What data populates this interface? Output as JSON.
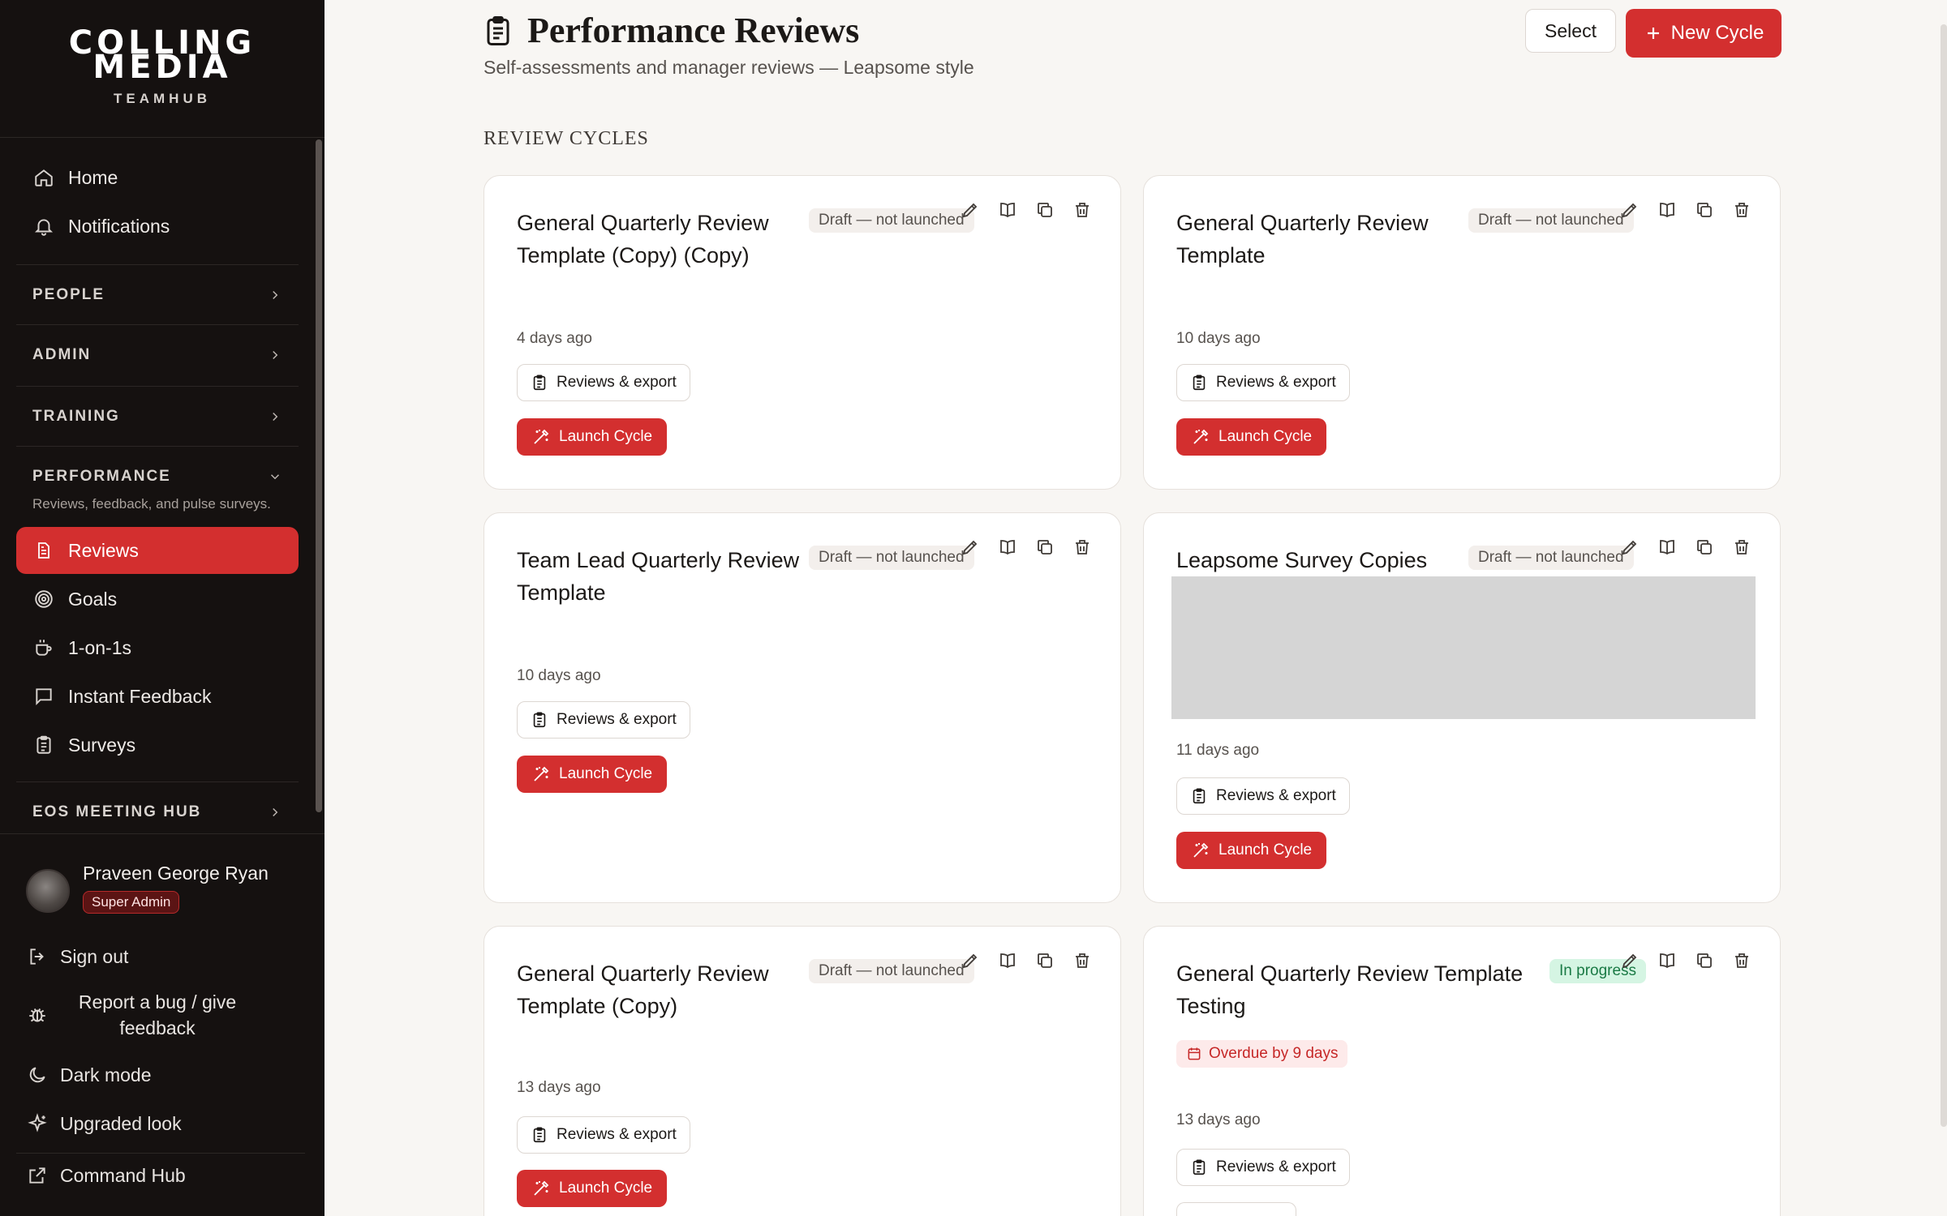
{
  "brand": {
    "name_line1": "COLLING",
    "name_line2": "MEDIA",
    "product": "TEAMHUB"
  },
  "nav": {
    "home": "Home",
    "notifications": "Notifications",
    "sections": [
      {
        "label": "PEOPLE"
      },
      {
        "label": "ADMIN"
      },
      {
        "label": "TRAINING"
      }
    ],
    "performance": {
      "label": "PERFORMANCE",
      "description": "Reviews, feedback, and pulse surveys.",
      "items": [
        "Reviews",
        "Goals",
        "1-on-1s",
        "Instant Feedback",
        "Surveys"
      ],
      "active": "Reviews"
    },
    "eos": "EOS MEETING HUB"
  },
  "user": {
    "name": "Praveen George Ryan",
    "role": "Super Admin"
  },
  "footer": {
    "sign_out": "Sign out",
    "report_line1": "Report a bug / give",
    "report_line2": "feedback",
    "dark_mode": "Dark mode",
    "upgraded_look": "Upgraded look",
    "command_hub": "Command Hub"
  },
  "header": {
    "title": "Performance Reviews",
    "subtitle": "Self-assessments and manager reviews — Leapsome style",
    "select_label": "Select",
    "new_cycle_label": "New Cycle"
  },
  "section_label": "REVIEW CYCLES",
  "card_labels": {
    "export": "Reviews & export",
    "launch": "Launch Cycle"
  },
  "cards": [
    {
      "title": "General Quarterly Review Template (Copy) (Copy)",
      "status": "Draft — not launched",
      "time": "4 days ago"
    },
    {
      "title": "General Quarterly Review Template",
      "status": "Draft — not launched",
      "time": "10 days ago"
    },
    {
      "title": "Team Lead Quarterly Review Template",
      "status": "Draft — not launched",
      "time": "10 days ago"
    },
    {
      "title": "Leapsome Survey Copies",
      "status": "Draft — not launched",
      "time": "11 days ago"
    },
    {
      "title": "General Quarterly Review Template (Copy)",
      "status": "Draft — not launched",
      "time": "13 days ago"
    },
    {
      "title": "General Quarterly Review Template Testing",
      "status": "In progress",
      "overdue": "Overdue by 9 days",
      "time": "13 days ago"
    }
  ],
  "colors": {
    "accent": "#d32f2f",
    "sidebar_bg": "#151110",
    "page_bg": "#f8f6f3",
    "success": "#1a7a45"
  }
}
